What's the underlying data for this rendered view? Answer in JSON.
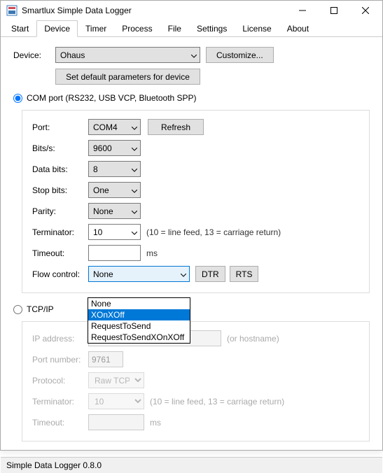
{
  "window": {
    "title": "Smartlux Simple Data Logger"
  },
  "tabs": [
    "Start",
    "Device",
    "Timer",
    "Process",
    "File",
    "Settings",
    "License",
    "About"
  ],
  "activeTab": "Device",
  "device": {
    "label": "Device:",
    "value": "Ohaus",
    "customize": "Customize...",
    "setDefaults": "Set default parameters for device"
  },
  "comport": {
    "radio": "COM port (RS232, USB VCP, Bluetooth SPP)",
    "selected": true,
    "port": {
      "label": "Port:",
      "value": "COM4",
      "refresh": "Refresh"
    },
    "bits": {
      "label": "Bits/s:",
      "value": "9600"
    },
    "databits": {
      "label": "Data bits:",
      "value": "8"
    },
    "stopbits": {
      "label": "Stop bits:",
      "value": "One"
    },
    "parity": {
      "label": "Parity:",
      "value": "None"
    },
    "terminator": {
      "label": "Terminator:",
      "value": "10",
      "hint": "(10 = line feed, 13 = carriage return)"
    },
    "timeout": {
      "label": "Timeout:",
      "value": "",
      "unit": "ms"
    },
    "flow": {
      "label": "Flow control:",
      "value": "None",
      "dtr": "DTR",
      "rts": "RTS",
      "options": [
        "None",
        "XOnXOff",
        "RequestToSend",
        "RequestToSendXOnXOff"
      ],
      "highlighted": "XOnXOff"
    }
  },
  "tcpip": {
    "radio": "TCP/IP",
    "selected": false,
    "ip": {
      "label": "IP address:",
      "value": "",
      "hint": "(or hostname)"
    },
    "port": {
      "label": "Port number:",
      "value": "9761"
    },
    "protocol": {
      "label": "Protocol:",
      "value": "Raw TCP"
    },
    "terminator": {
      "label": "Terminator:",
      "value": "10",
      "hint": "(10 = line feed, 13 = carriage return)"
    },
    "timeout": {
      "label": "Timeout:",
      "value": "",
      "unit": "ms"
    }
  },
  "statusbar": "Simple Data Logger 0.8.0"
}
